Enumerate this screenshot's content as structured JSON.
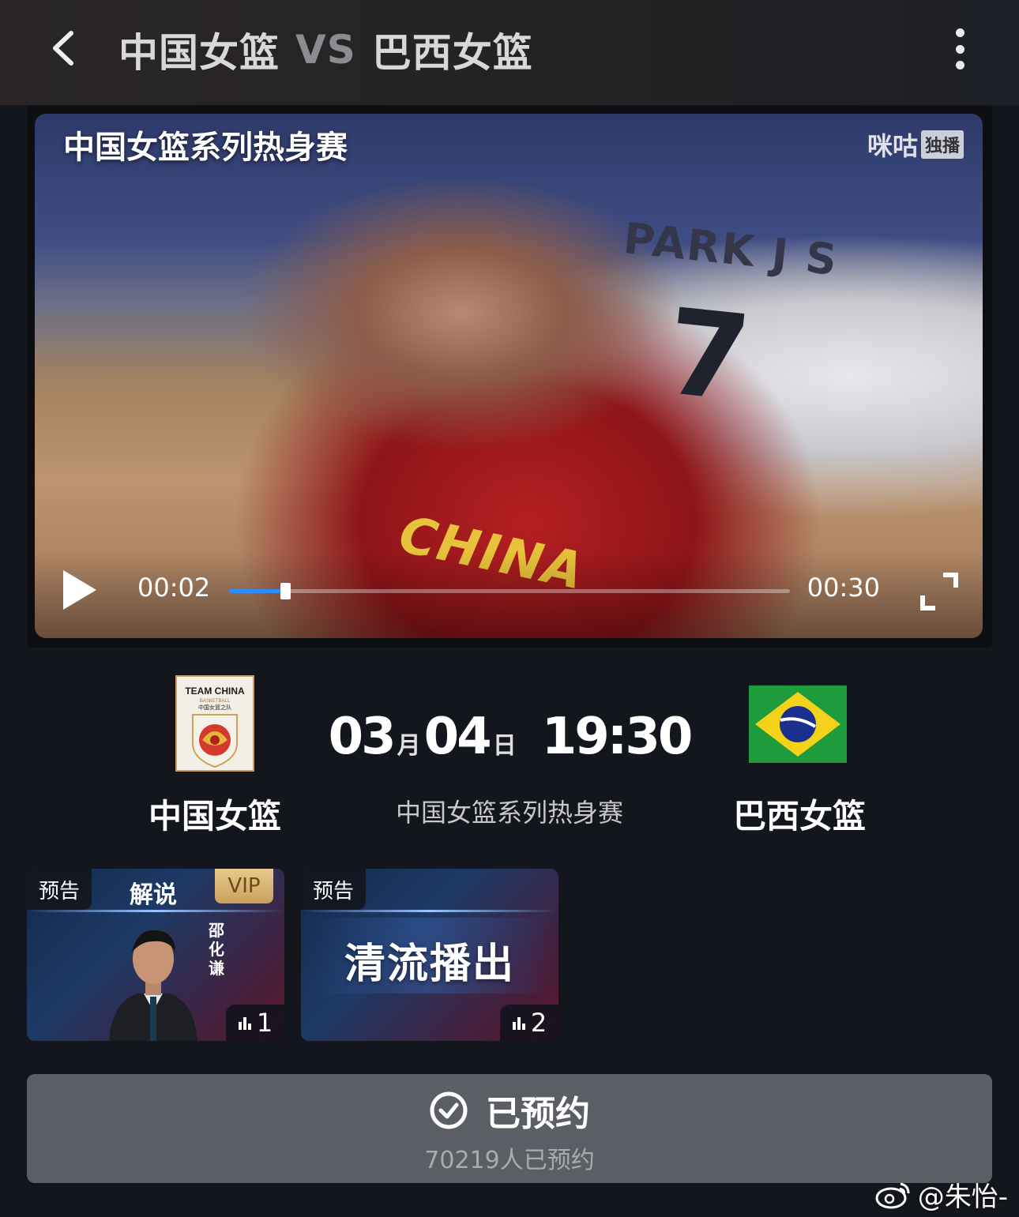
{
  "header": {
    "team_home": "中国女篮",
    "vs": "VS",
    "team_away": "巴西女篮"
  },
  "player": {
    "overlay_title": "中国女篮系列热身赛",
    "watermark_brand": "咪咕",
    "watermark_badge": "独播",
    "jersey_text": "CHINA",
    "opponent_name": "PARK J S",
    "opponent_number": "7",
    "current_time": "00:02",
    "duration": "00:30",
    "progress_fraction": 0.1,
    "accent_color": "#2f8cff"
  },
  "match": {
    "home": {
      "name": "中国女篮",
      "logo_top": "TEAM CHINA",
      "logo_sub": "BASKETBALL",
      "logo_cn": "中国女篮之队"
    },
    "away": {
      "name": "巴西女篮"
    },
    "month": "03",
    "month_unit": "月",
    "day": "04",
    "day_unit": "日",
    "time": "19:30",
    "event": "中国女篮系列热身赛"
  },
  "streams": [
    {
      "tag": "预告",
      "label": "解说",
      "vip": "VIP",
      "commentator": "邵化谦",
      "count": "1"
    },
    {
      "tag": "预告",
      "title": "清流播出",
      "count": "2"
    }
  ],
  "reserve": {
    "status": "已预约",
    "count_text": "70219人已预约"
  },
  "credit": {
    "handle": "@朱怡-"
  }
}
